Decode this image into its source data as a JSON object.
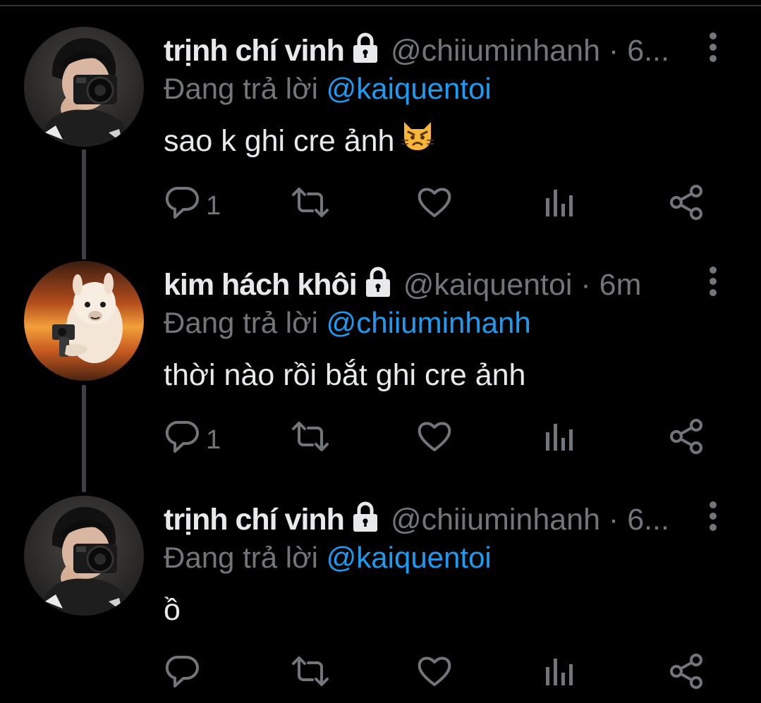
{
  "tweets": [
    {
      "display_name": "trịnh chí vinh",
      "handle_meta": "@chiiuminhanh · 6...",
      "replying_prefix": "Đang trả lời ",
      "replying_to": "@kaiquentoi",
      "text": "sao k ghi cre ảnh",
      "emoji": "pouting-cat-emoji",
      "reply_count": "1",
      "avatar": "person-with-camera"
    },
    {
      "display_name": "kim hách khôi",
      "handle_meta": "@kaiquentoi · 6m",
      "replying_prefix": "Đang trả lời ",
      "replying_to": "@chiiuminhanh",
      "text": "thời nào rồi bắt ghi cre ảnh",
      "reply_count": "1",
      "avatar": "alpaca-with-gun"
    },
    {
      "display_name": "trịnh chí vinh",
      "handle_meta": "@chiiuminhanh · 6...",
      "replying_prefix": "Đang trả lời ",
      "replying_to": "@kaiquentoi",
      "text": "ồ",
      "reply_count": "",
      "avatar": "person-with-camera"
    }
  ],
  "icons": {
    "reply": "reply-icon",
    "retweet": "retweet-icon",
    "like": "heart-icon",
    "views": "analytics-icon",
    "share": "share-icon",
    "more": "more-vertical-icon",
    "lock": "lock-icon"
  },
  "colors": {
    "background": "#000000",
    "text": "#e7e9ea",
    "secondary": "#71767b",
    "mention": "#1d9bf0",
    "thread_line": "#3e4144"
  }
}
